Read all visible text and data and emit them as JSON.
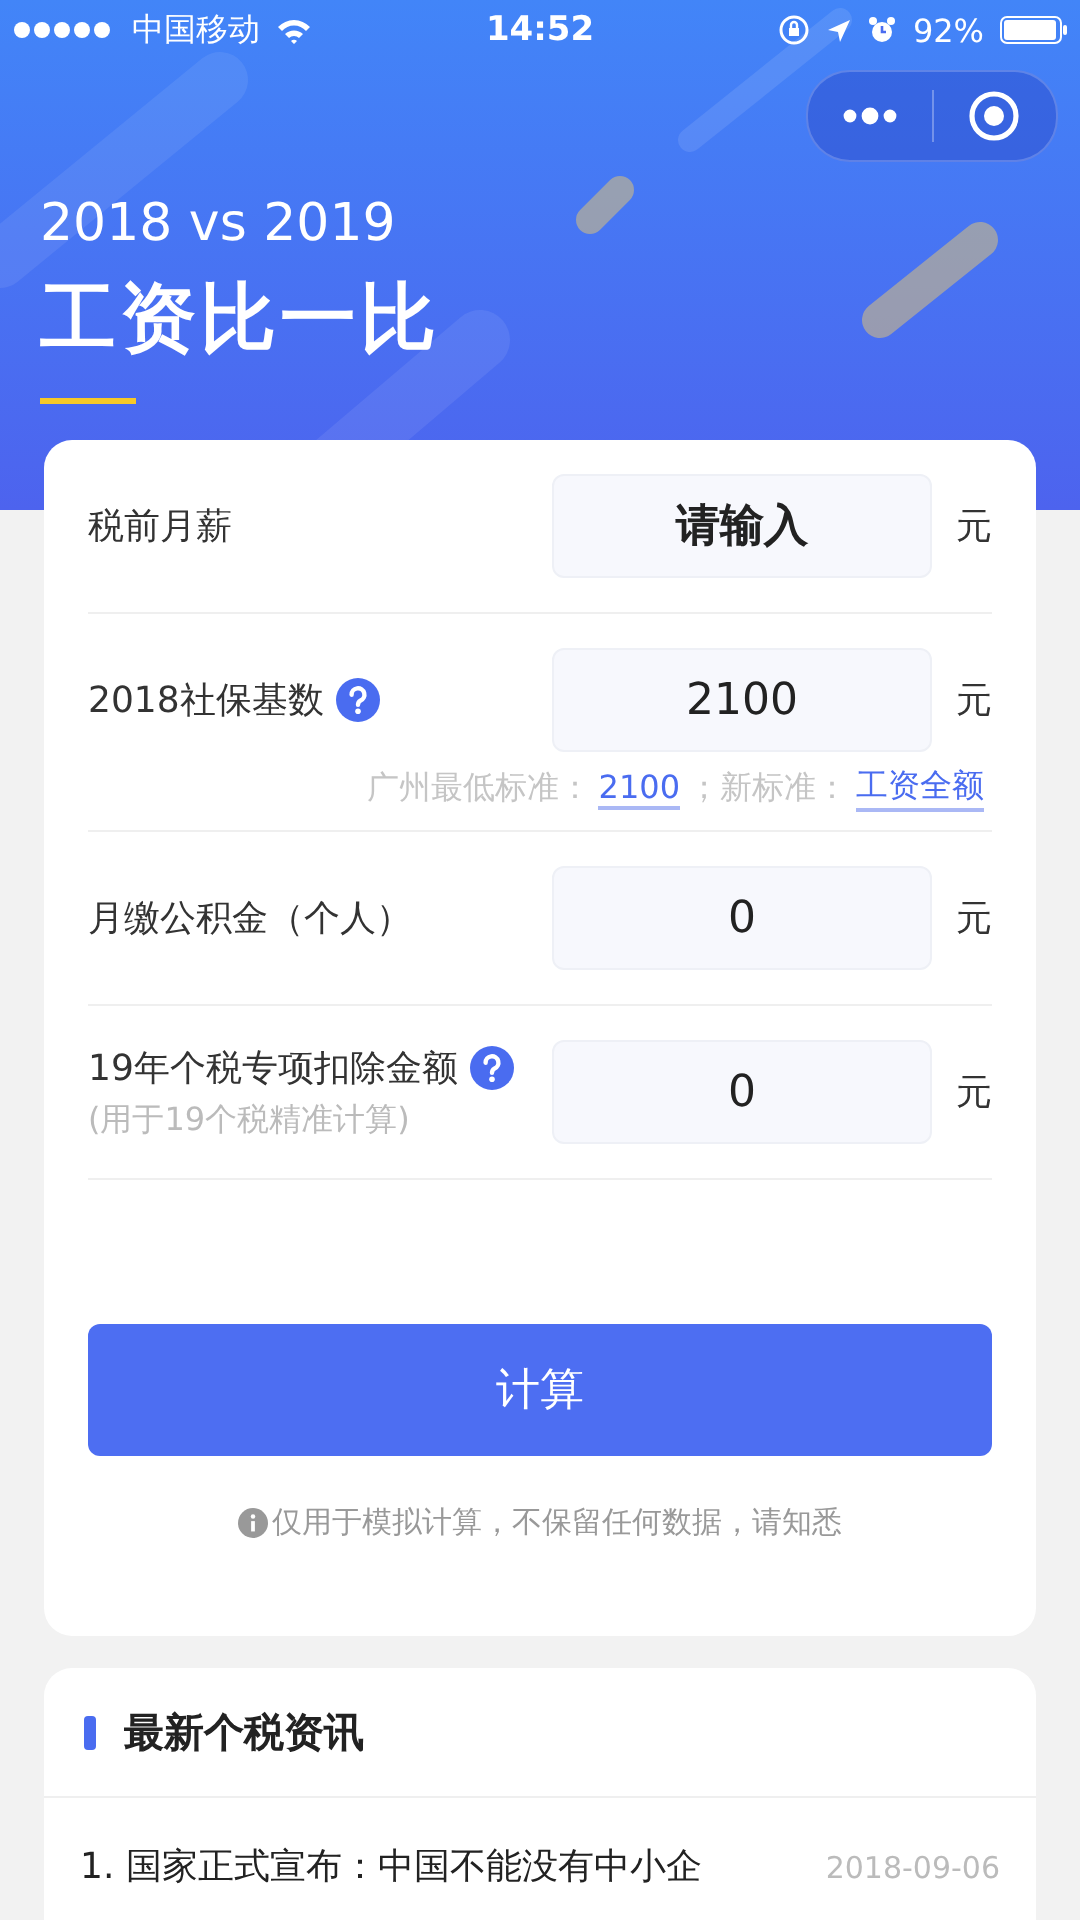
{
  "status_bar": {
    "carrier": "中国移动",
    "time": "14:52",
    "battery": "92%"
  },
  "header": {
    "subtitle": "2018 vs 2019",
    "title": "工资比一比"
  },
  "form": {
    "rows": [
      {
        "label": "税前月薪",
        "help": false,
        "placeholder": "请输入",
        "unit": "元"
      },
      {
        "label": "2018社保基数",
        "help": true,
        "value": "2100",
        "unit": "元",
        "hint": [
          {
            "kind": "text",
            "text": "广州最低标准："
          },
          {
            "kind": "link",
            "text": "2100"
          },
          {
            "kind": "text",
            "text": "；新标准："
          },
          {
            "kind": "link",
            "text": "工资全额"
          }
        ]
      },
      {
        "label": "月缴公积金（个人）",
        "help": false,
        "value": "0",
        "unit": "元"
      },
      {
        "label": "19年个税专项扣除金额",
        "help": true,
        "sublabel": "(用于19个税精准计算)",
        "value": "0",
        "unit": "元"
      }
    ],
    "button": "计算",
    "note": "仅用于模拟计算，不保留任何数据，请知悉"
  },
  "news": {
    "title": "最新个税资讯",
    "items": [
      {
        "text": "1. 国家正式宣布：中国不能没有中小企",
        "date": "2018-09-06"
      }
    ]
  }
}
